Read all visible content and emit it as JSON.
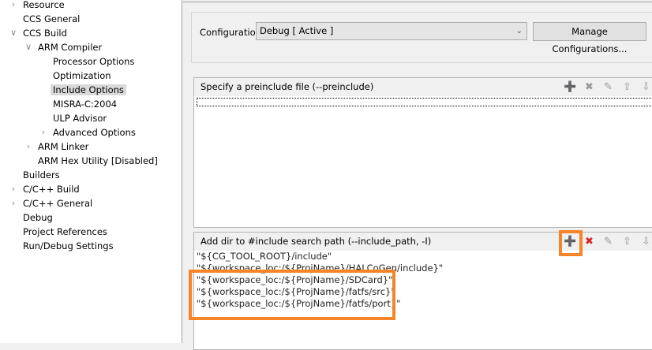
{
  "tree": [
    {
      "label": "Resource",
      "level": 0,
      "expander": "collapsed"
    },
    {
      "label": "CCS General",
      "level": 0,
      "expander": "none"
    },
    {
      "label": "CCS Build",
      "level": 0,
      "expander": "expanded"
    },
    {
      "label": "ARM Compiler",
      "level": 1,
      "expander": "expanded"
    },
    {
      "label": "Processor Options",
      "level": 2,
      "expander": "none"
    },
    {
      "label": "Optimization",
      "level": 2,
      "expander": "none"
    },
    {
      "label": "Include Options",
      "level": 2,
      "expander": "none",
      "selected": true
    },
    {
      "label": "MISRA-C:2004",
      "level": 2,
      "expander": "none"
    },
    {
      "label": "ULP Advisor",
      "level": 2,
      "expander": "none"
    },
    {
      "label": "Advanced Options",
      "level": 2,
      "expander": "collapsed"
    },
    {
      "label": "ARM Linker",
      "level": 1,
      "expander": "collapsed"
    },
    {
      "label": "ARM Hex Utility  [Disabled]",
      "level": 1,
      "expander": "none"
    },
    {
      "label": "Builders",
      "level": 0,
      "expander": "none"
    },
    {
      "label": "C/C++ Build",
      "level": 0,
      "expander": "collapsed"
    },
    {
      "label": "C/C++ General",
      "level": 0,
      "expander": "collapsed"
    },
    {
      "label": "Debug",
      "level": 0,
      "expander": "none"
    },
    {
      "label": "Project References",
      "level": 0,
      "expander": "none"
    },
    {
      "label": "Run/Debug Settings",
      "level": 0,
      "expander": "none"
    }
  ],
  "configuration": {
    "label": "Configuration:",
    "value": "Debug  [ Active ]",
    "manage_label": "Manage Configurations..."
  },
  "preinclude": {
    "title": "Specify a preinclude file (--preinclude)",
    "entries": []
  },
  "include_path": {
    "title": "Add dir to #include search path (--include_path, -I)",
    "entries": [
      "\"${CG_TOOL_ROOT}/include\"",
      "\"${workspace_loc:/${ProjName}/HALCoGen/include}\"",
      "\"${workspace_loc:/${ProjName}/SDCard}\"",
      "\"${workspace_loc:/${ProjName}/fatfs/src}\"",
      "\"${workspace_loc:/${ProjName}/fatfs/port}\""
    ]
  },
  "toolbar_icons": [
    "add-icon",
    "delete-icon",
    "edit-icon",
    "move-up-icon",
    "move-down-icon"
  ],
  "highlight_color": "#f68528"
}
